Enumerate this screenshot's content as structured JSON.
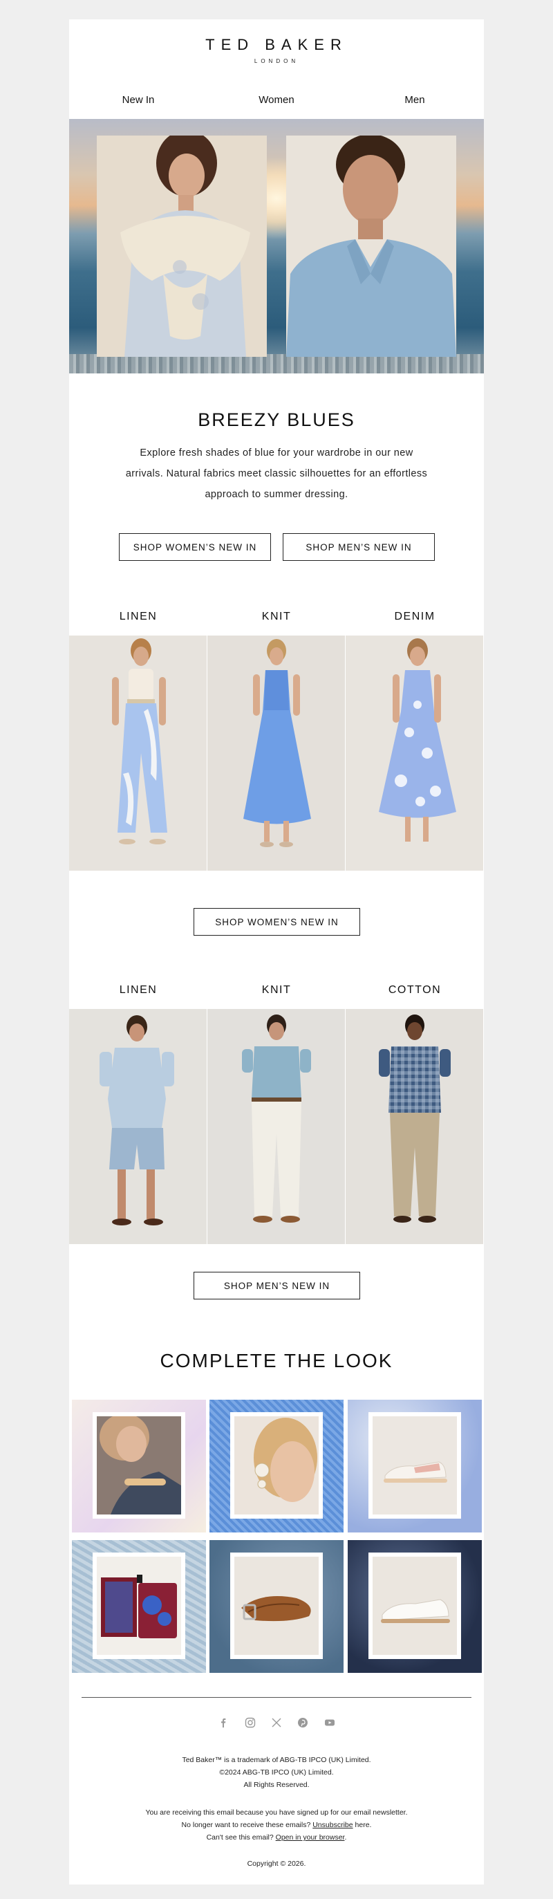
{
  "brand": {
    "name": "TED BAKER",
    "sub": "LONDON"
  },
  "nav": [
    {
      "label": "New In"
    },
    {
      "label": "Women"
    },
    {
      "label": "Men"
    }
  ],
  "hero": {
    "title": "BREEZY BLUES",
    "intro": "Explore fresh shades of blue for your wardrobe in our new arrivals. Natural fabrics meet classic silhouettes for an effortless approach to summer dressing."
  },
  "buttons": {
    "shop_womens": "SHOP WOMEN’S NEW IN",
    "shop_mens": "SHOP MEN’S NEW IN"
  },
  "women_categories": [
    {
      "label": "LINEN"
    },
    {
      "label": "KNIT"
    },
    {
      "label": "DENIM"
    }
  ],
  "men_categories": [
    {
      "label": "LINEN"
    },
    {
      "label": "KNIT"
    },
    {
      "label": "COTTON"
    }
  ],
  "look": {
    "title": "COMPLETE THE LOOK"
  },
  "social_icons": [
    "facebook-icon",
    "instagram-icon",
    "x-icon",
    "pinterest-icon",
    "youtube-icon"
  ],
  "footer": {
    "trademark": "Ted Baker™ is a trademark of ABG-TB IPCO (UK) Limited.",
    "copyright_company": "©2024 ABG-TB IPCO (UK) Limited.",
    "rights": "All Rights Reserved.",
    "reason": "You are receiving this email because you have signed up for our email newsletter.",
    "unsub_prefix": "No longer want to receive these emails?",
    "unsub_link": "Unsubscribe",
    "unsub_suffix": "here.",
    "browser_prefix": "Can't see this email?",
    "browser_link": "Open in your browser",
    "browser_suffix": ".",
    "copyright_year": "Copyright © 2026."
  },
  "colors": {
    "background": "#efefef",
    "panel": "#ffffff",
    "text": "#111111",
    "denim": "#6e8fd6"
  }
}
